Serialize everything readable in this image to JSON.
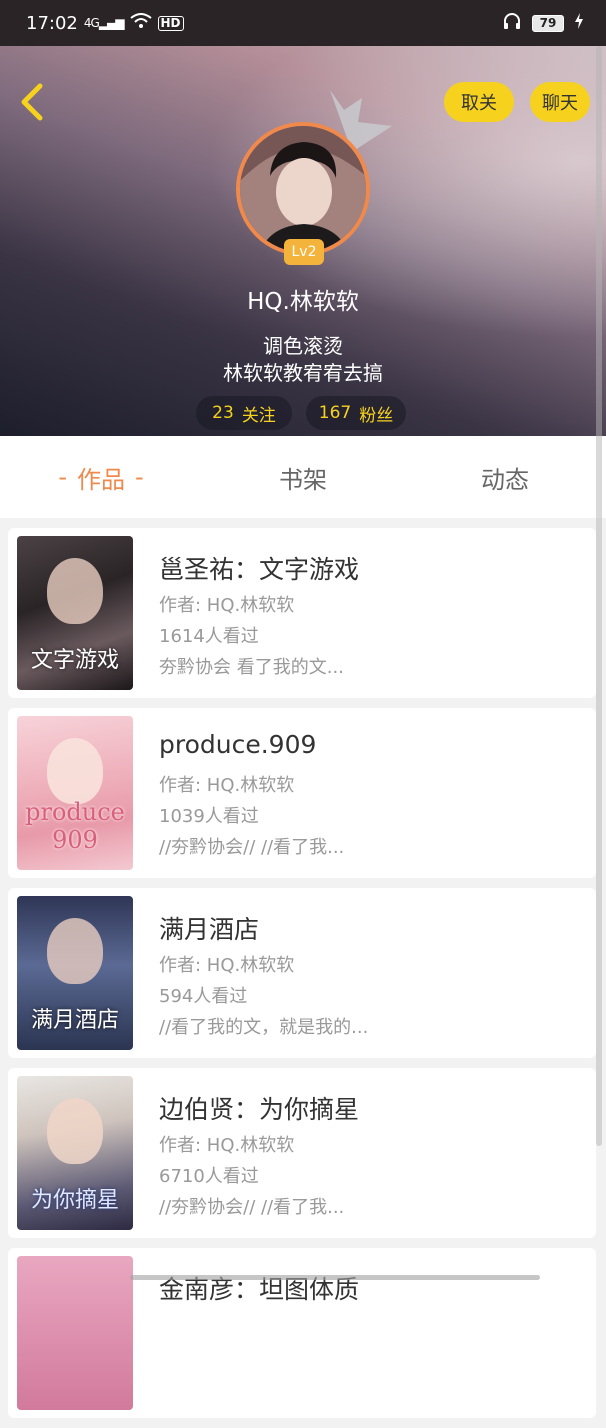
{
  "status_bar": {
    "time": "17:02",
    "signal_label": "4G",
    "hd_label": "HD",
    "battery": "79"
  },
  "header": {
    "unfollow_label": "取关",
    "chat_label": "聊天",
    "level": "Lv2",
    "username": "HQ.林软软",
    "bio_line1": "调色滚烫",
    "bio_line2": "林软软教宥宥去搞",
    "follow_count": "23",
    "follow_label": "关注",
    "fans_count": "167",
    "fans_label": "粉丝",
    "accent_color": "#f6d21e"
  },
  "tabs": [
    {
      "label": "作品",
      "active": true
    },
    {
      "label": "书架",
      "active": false
    },
    {
      "label": "动态",
      "active": false
    }
  ],
  "tab_dash": "-",
  "books": [
    {
      "title": "邕圣祐：文字游戏",
      "author": "作者: HQ.林软软",
      "views": "1614人看过",
      "desc": "夯黔协会 看了我的文...",
      "cover_text": "文字游戏"
    },
    {
      "title": "produce.909",
      "author": "作者: HQ.林软软",
      "views": "1039人看过",
      "desc": "//夯黔协会// //看了我...",
      "cover_text": "produce 909"
    },
    {
      "title": "满月酒店",
      "author": "作者: HQ.林软软",
      "views": "594人看过",
      "desc": "//看了我的文，就是我的...",
      "cover_text": "满月酒店"
    },
    {
      "title": "边伯贤：为你摘星",
      "author": "作者: HQ.林软软",
      "views": "6710人看过",
      "desc": "//夯黔协会// //看了我...",
      "cover_text": "为你摘星"
    },
    {
      "title": "金南彦：坦图体质",
      "author": "",
      "views": "",
      "desc": "",
      "cover_text": ""
    }
  ]
}
